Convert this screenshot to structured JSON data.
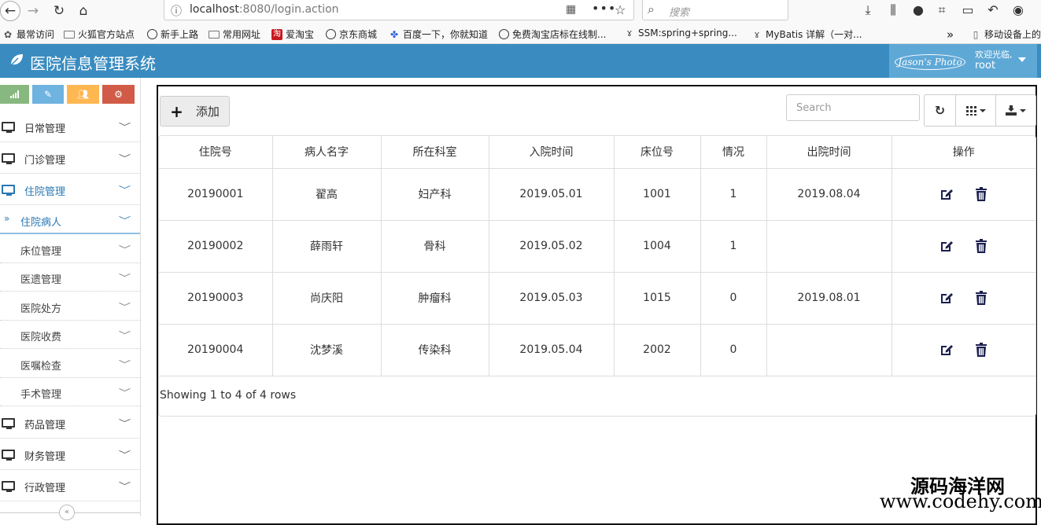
{
  "browser": {
    "url_host": "localhost",
    "url_path": ":8080/login.action",
    "search_placeholder": "搜索",
    "bookmarks": [
      {
        "label": "最常访问"
      },
      {
        "label": "火狐官方站点"
      },
      {
        "label": "新手上路"
      },
      {
        "label": "常用网址"
      },
      {
        "label": "爱淘宝"
      },
      {
        "label": "京东商城"
      },
      {
        "label": "百度一下，你就知道"
      },
      {
        "label": "免费淘宝店标在线制..."
      },
      {
        "label": "SSM:spring+spring..."
      },
      {
        "label": "MyBatis 详解（一对..."
      },
      {
        "label": "移动设备上的书"
      }
    ]
  },
  "header": {
    "title": "医院信息管理系统",
    "avatar_alt": "Jason's Photo",
    "welcome": "欢迎光临,",
    "username": "root",
    "bg_color": "#3a8cc0"
  },
  "sidebar": {
    "shortcut_colors": [
      "#87b87f",
      "#6fb3e0",
      "#ffb752",
      "#d15b47"
    ],
    "menu": [
      {
        "label": "日常管理"
      },
      {
        "label": "门诊管理"
      },
      {
        "label": "住院管理"
      }
    ],
    "submenu": [
      {
        "label": "住院病人"
      },
      {
        "label": "床位管理"
      },
      {
        "label": "医遗管理"
      },
      {
        "label": "医院处方"
      },
      {
        "label": "医院收费"
      },
      {
        "label": "医嘱检查"
      },
      {
        "label": "手术管理"
      }
    ],
    "menu_bottom": [
      {
        "label": "药品管理"
      },
      {
        "label": "财务管理"
      },
      {
        "label": "行政管理"
      }
    ]
  },
  "toolbar": {
    "add_label": "添加",
    "search_placeholder": "Search"
  },
  "table": {
    "columns": [
      "住院号",
      "病人名字",
      "所在科室",
      "入院时间",
      "床位号",
      "情况",
      "出院时间",
      "操作"
    ],
    "rows": [
      [
        "20190001",
        "翟高",
        "妇产科",
        "2019.05.01",
        "1001",
        "1",
        "2019.08.04"
      ],
      [
        "20190002",
        "薛雨轩",
        "骨科",
        "2019.05.02",
        "1004",
        "1",
        ""
      ],
      [
        "20190003",
        "尚庆阳",
        "肿瘤科",
        "2019.05.03",
        "1015",
        "0",
        "2019.08.01"
      ],
      [
        "20190004",
        "沈梦溪",
        "传染科",
        "2019.05.04",
        "2002",
        "0",
        ""
      ]
    ],
    "pagination": "Showing 1 to 4 of 4 rows"
  },
  "watermark": {
    "cn": "源码海洋网",
    "url": "www.codehy.com"
  }
}
